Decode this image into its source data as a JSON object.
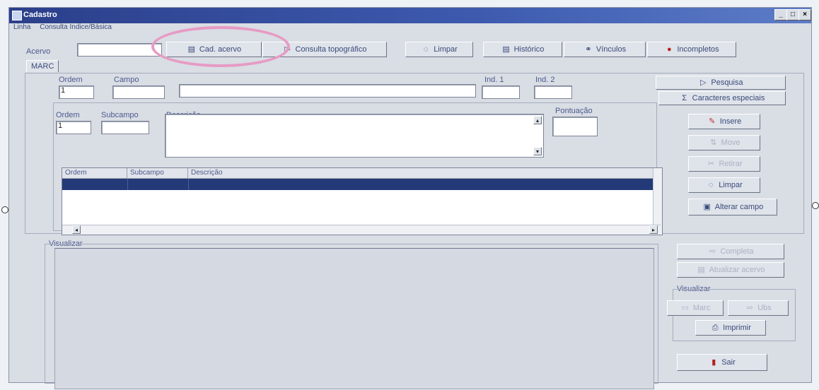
{
  "window": {
    "title": "Cadastro"
  },
  "menu": [
    "Linha",
    "Consulta Indice/Básica"
  ],
  "toolbar": {
    "acervo_label": "Acervo",
    "acervo_value": "",
    "buttons": [
      {
        "label": "Cad. acervo",
        "icon": "books-icon"
      },
      {
        "label": "Consulta topográfico",
        "icon": "arrow-search-icon"
      },
      {
        "label": "Limpar",
        "icon": "clear-icon"
      },
      {
        "label": "Histórico",
        "icon": "history-icon"
      },
      {
        "label": "Vínculos",
        "icon": "link-icon"
      },
      {
        "label": "Incompletos",
        "icon": "incomplete-icon"
      }
    ]
  },
  "tab": {
    "label": "MARC"
  },
  "campo_section": {
    "ordem_label": "Ordem",
    "ordem_value": "1",
    "campo_label": "Campo",
    "campo_value": "",
    "description_value": "",
    "ind1_label": "Ind. 1",
    "ind2_label": "Ind. 2"
  },
  "subcampo_section": {
    "ordem_label": "Ordem",
    "ordem_value": "1",
    "subcampo_label": "Subcampo",
    "descricao_label": "Descrição",
    "pontuacao_label": "Pontuação"
  },
  "grid": {
    "columns": [
      "Ordem",
      "Subcampo",
      "Descrição"
    ]
  },
  "right_buttons": {
    "pesquisa": "Pesquisa",
    "caracteres": "Caracteres especiais",
    "insere": "Insere",
    "move": "Move",
    "retirar": "Retirar",
    "limpar": "Limpar",
    "alterar": "Alterar campo",
    "completa": "Completa",
    "atualizar": "Atualizar acervo",
    "visualizar_group": "Visualizar",
    "marc": "Marc",
    "ubs": "Ubs",
    "imprimir": "Imprimir",
    "sair": "Sair"
  },
  "visualizar": {
    "label": "Visualizar"
  },
  "colors": {
    "titlebar": "#2b3f8a",
    "selection": "#243a78",
    "highlight": "#e69bc4"
  }
}
